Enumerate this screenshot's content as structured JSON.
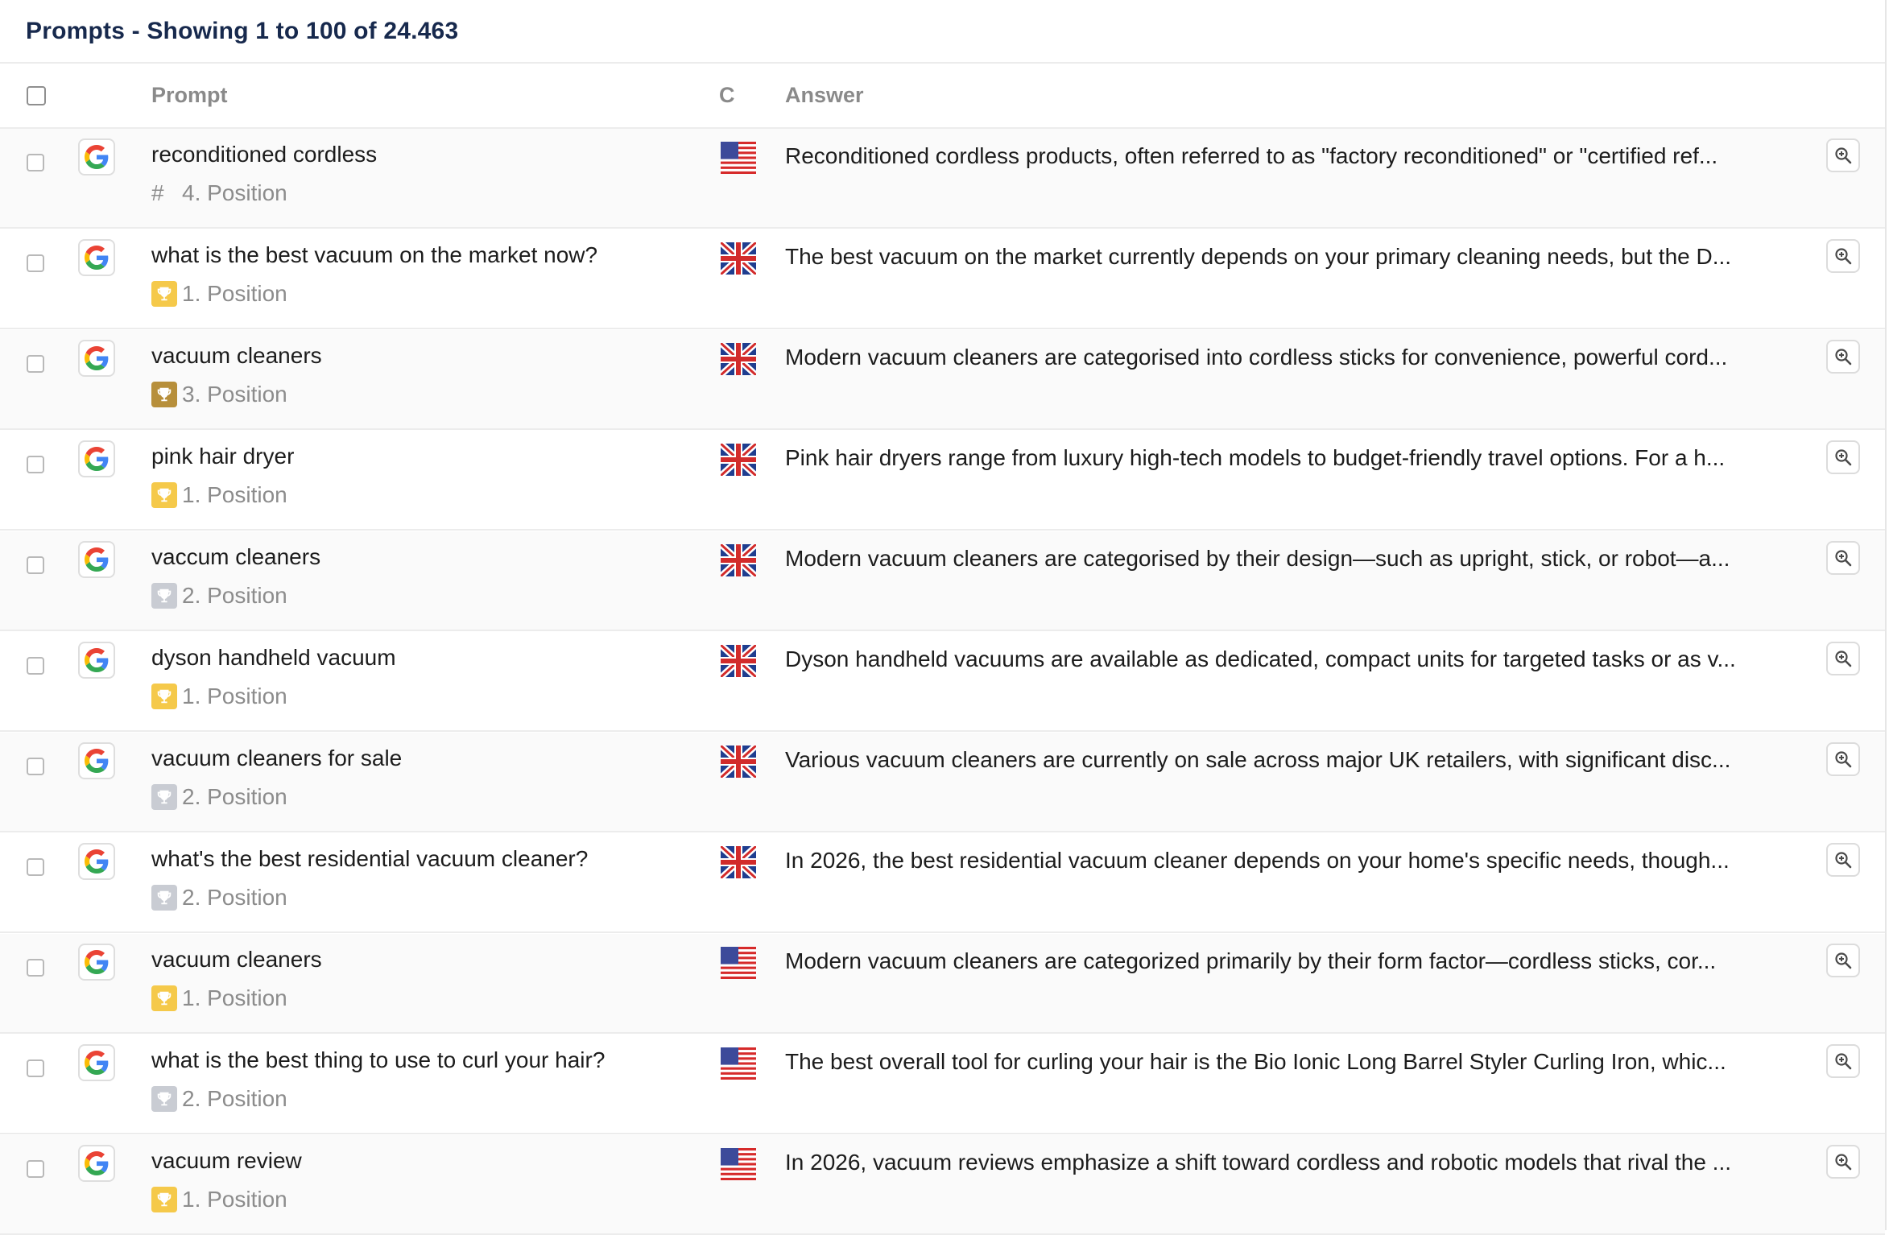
{
  "header": {
    "title": "Prompts - Showing 1 to 100 of 24.463"
  },
  "columns": {
    "prompt": "Prompt",
    "country": "C",
    "answer": "Answer"
  },
  "colors": {
    "title": "#17294d",
    "trophy_gold": "#f5c94a",
    "trophy_bronze": "#b78f3b",
    "trophy_silver": "#c9ccd3"
  },
  "rows": [
    {
      "prompt": "reconditioned cordless",
      "position_label": "4. Position",
      "position": 4,
      "badge": "hash",
      "country": "us",
      "answer": "Reconditioned cordless products, often referred to as \"factory reconditioned\" or \"certified ref..."
    },
    {
      "prompt": "what is the best vacuum on the market now?",
      "position_label": "1. Position",
      "position": 1,
      "badge": "gold",
      "country": "gb",
      "answer": "The best vacuum on the market currently depends on your primary cleaning needs, but the D..."
    },
    {
      "prompt": "vacuum cleaners",
      "position_label": "3. Position",
      "position": 3,
      "badge": "bronze",
      "country": "gb",
      "answer": "Modern vacuum cleaners are categorised into cordless sticks for convenience, powerful cord..."
    },
    {
      "prompt": "pink hair dryer",
      "position_label": "1. Position",
      "position": 1,
      "badge": "gold",
      "country": "gb",
      "answer": "Pink hair dryers range from luxury high-tech models to budget-friendly travel options. For a h..."
    },
    {
      "prompt": "vaccum cleaners",
      "position_label": "2. Position",
      "position": 2,
      "badge": "silver",
      "country": "gb",
      "answer": "Modern vacuum cleaners are categorised by their design—such as upright, stick, or robot—a..."
    },
    {
      "prompt": "dyson handheld vacuum",
      "position_label": "1. Position",
      "position": 1,
      "badge": "gold",
      "country": "gb",
      "answer": "Dyson handheld vacuums are available as dedicated, compact units for targeted tasks or as v..."
    },
    {
      "prompt": "vacuum cleaners for sale",
      "position_label": "2. Position",
      "position": 2,
      "badge": "silver",
      "country": "gb",
      "answer": "Various vacuum cleaners are currently on sale across major UK retailers, with significant disc..."
    },
    {
      "prompt": "what's the best residential vacuum cleaner?",
      "position_label": "2. Position",
      "position": 2,
      "badge": "silver",
      "country": "gb",
      "answer": "In 2026, the best residential vacuum cleaner depends on your home's specific needs, though..."
    },
    {
      "prompt": "vacuum cleaners",
      "position_label": "1. Position",
      "position": 1,
      "badge": "gold",
      "country": "us",
      "answer": "Modern vacuum cleaners are categorized primarily by their form factor—cordless sticks, cor..."
    },
    {
      "prompt": "what is the best thing to use to curl your hair?",
      "position_label": "2. Position",
      "position": 2,
      "badge": "silver",
      "country": "us",
      "answer": "The best overall tool for curling your hair is the Bio Ionic Long Barrel Styler Curling Iron, whic..."
    },
    {
      "prompt": "vacuum review",
      "position_label": "1. Position",
      "position": 1,
      "badge": "gold",
      "country": "us",
      "answer": "In 2026, vacuum reviews emphasize a shift toward cordless and robotic models that rival the ..."
    }
  ]
}
